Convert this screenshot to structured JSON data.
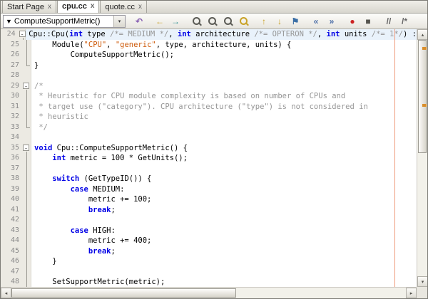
{
  "colors": {
    "keyword": "#0000E6",
    "string": "#CE5B0B",
    "comment": "#969696",
    "plain": "#000000",
    "line-number": "#8A8A8A",
    "gutter-bg": "#ECEAE3",
    "current-line-bg": "#E9F2FB",
    "margin-line": "#EE9B7D",
    "error-mark": "#D98E2B"
  },
  "tabs": {
    "active_index": 1,
    "close_glyph": "x",
    "items": [
      {
        "label": "Start Page"
      },
      {
        "label": "cpu.cc"
      },
      {
        "label": "quote.cc"
      }
    ]
  },
  "toolbar": {
    "selector": {
      "icon": "member-filter-icon",
      "icon_glyph": "▼",
      "icon_color": "#E8A33D",
      "value": "ComputeSupportMetric()",
      "arrow_glyph": "▾"
    },
    "groups": [
      [
        {
          "name": "last-edit-location-icon",
          "glyph": "↶",
          "color": "#8A63B3"
        }
      ],
      [
        {
          "name": "back-icon",
          "glyph": "←",
          "color": "#C9A227"
        },
        {
          "name": "forward-icon",
          "glyph": "→",
          "color": "#2F8F8F"
        }
      ],
      [
        {
          "name": "find-icon",
          "mag": true,
          "color": "#5B5B55"
        },
        {
          "name": "find-next-icon",
          "mag": true,
          "color": "#5B5B55"
        },
        {
          "name": "find-previous-icon",
          "mag": true,
          "color": "#5B5B55"
        },
        {
          "name": "toggle-highlight-icon",
          "mag": true,
          "color": "#C9A227"
        }
      ],
      [
        {
          "name": "previous-bookmark-icon",
          "glyph": "↑",
          "color": "#C9A227"
        },
        {
          "name": "next-bookmark-icon",
          "glyph": "↓",
          "color": "#C9A227"
        },
        {
          "name": "toggle-bookmark-icon",
          "glyph": "⚑",
          "color": "#3A6EA5"
        }
      ],
      [
        {
          "name": "shift-left-icon",
          "glyph": "«",
          "color": "#4A6DA7"
        },
        {
          "name": "shift-right-icon",
          "glyph": "»",
          "color": "#4A6DA7"
        }
      ],
      [
        {
          "name": "start-macro-recording-icon",
          "glyph": "●",
          "color": "#CC2222"
        },
        {
          "name": "stop-macro-recording-icon",
          "glyph": "■",
          "color": "#55544E"
        }
      ],
      [
        {
          "name": "comment-icon",
          "glyph": "//",
          "color": "#666666"
        },
        {
          "name": "uncomment-icon",
          "glyph": "/*",
          "color": "#666666"
        }
      ]
    ]
  },
  "editor": {
    "current_line": 24,
    "fold_glyph": "-",
    "lines": [
      {
        "n": 24,
        "fold": "start",
        "segs": [
          [
            "p",
            "Cpu::Cpu("
          ],
          [
            "k",
            "int"
          ],
          [
            "p",
            " type "
          ],
          [
            "c",
            "/*= MEDIUM */"
          ],
          [
            "p",
            ", "
          ],
          [
            "k",
            "int"
          ],
          [
            "p",
            " architecture "
          ],
          [
            "c",
            "/*= OPTERON */"
          ],
          [
            "p",
            ", "
          ],
          [
            "k",
            "int"
          ],
          [
            "p",
            " units "
          ],
          [
            "c",
            "/*= 1*/"
          ],
          [
            "p",
            ") :"
          ]
        ]
      },
      {
        "n": 25,
        "fold": "mid",
        "segs": [
          [
            "p",
            "    Module("
          ],
          [
            "s",
            "\"CPU\""
          ],
          [
            "p",
            ", "
          ],
          [
            "s",
            "\"generic\""
          ],
          [
            "p",
            ", type, architecture, units) {"
          ]
        ]
      },
      {
        "n": 26,
        "fold": "mid",
        "segs": [
          [
            "p",
            "        ComputeSupportMetric();"
          ]
        ]
      },
      {
        "n": 27,
        "fold": "end",
        "segs": [
          [
            "p",
            "}"
          ]
        ]
      },
      {
        "n": 28,
        "fold": "none",
        "segs": []
      },
      {
        "n": 29,
        "fold": "start",
        "segs": [
          [
            "c",
            "/*"
          ]
        ]
      },
      {
        "n": 30,
        "fold": "mid",
        "segs": [
          [
            "c",
            " * Heuristic for CPU module complexity is based on number of CPUs and"
          ]
        ]
      },
      {
        "n": 31,
        "fold": "mid",
        "segs": [
          [
            "c",
            " * target use (\"category\"). CPU architecture (\"type\") is not considered in"
          ]
        ]
      },
      {
        "n": 32,
        "fold": "mid",
        "segs": [
          [
            "c",
            " * heuristic"
          ]
        ]
      },
      {
        "n": 33,
        "fold": "end",
        "segs": [
          [
            "c",
            " */"
          ]
        ]
      },
      {
        "n": 34,
        "fold": "none",
        "segs": []
      },
      {
        "n": 35,
        "fold": "start",
        "segs": [
          [
            "k",
            "void"
          ],
          [
            "p",
            " Cpu::ComputeSupportMetric() {"
          ]
        ]
      },
      {
        "n": 36,
        "fold": "mid",
        "segs": [
          [
            "p",
            "    "
          ],
          [
            "k",
            "int"
          ],
          [
            "p",
            " metric = 100 * GetUnits();"
          ]
        ]
      },
      {
        "n": 37,
        "fold": "mid",
        "segs": []
      },
      {
        "n": 38,
        "fold": "mid",
        "segs": [
          [
            "p",
            "    "
          ],
          [
            "k",
            "switch"
          ],
          [
            "p",
            " (GetTypeID()) {"
          ]
        ]
      },
      {
        "n": 39,
        "fold": "mid",
        "segs": [
          [
            "p",
            "        "
          ],
          [
            "k",
            "case"
          ],
          [
            "p",
            " MEDIUM:"
          ]
        ]
      },
      {
        "n": 40,
        "fold": "mid",
        "segs": [
          [
            "p",
            "            metric += 100;"
          ]
        ]
      },
      {
        "n": 41,
        "fold": "mid",
        "segs": [
          [
            "p",
            "            "
          ],
          [
            "k",
            "break"
          ],
          [
            "p",
            ";"
          ]
        ]
      },
      {
        "n": 42,
        "fold": "mid",
        "segs": []
      },
      {
        "n": 43,
        "fold": "mid",
        "segs": [
          [
            "p",
            "        "
          ],
          [
            "k",
            "case"
          ],
          [
            "p",
            " HIGH:"
          ]
        ]
      },
      {
        "n": 44,
        "fold": "mid",
        "segs": [
          [
            "p",
            "            metric += 400;"
          ]
        ]
      },
      {
        "n": 45,
        "fold": "mid",
        "segs": [
          [
            "p",
            "            "
          ],
          [
            "k",
            "break"
          ],
          [
            "p",
            ";"
          ]
        ]
      },
      {
        "n": 46,
        "fold": "mid",
        "segs": [
          [
            "p",
            "    }"
          ]
        ]
      },
      {
        "n": 47,
        "fold": "mid",
        "segs": []
      },
      {
        "n": 48,
        "fold": "mid",
        "segs": [
          [
            "p",
            "    SetSupportMetric(metric);"
          ]
        ]
      }
    ]
  },
  "scrollbars": {
    "up_glyph": "▴",
    "down_glyph": "▾",
    "left_glyph": "◂",
    "right_glyph": "▸",
    "vertical": {
      "thumb_top_pct": 0,
      "thumb_height_pct": 48,
      "marks_pct": [
        7,
        29
      ]
    },
    "horizontal": {
      "thumb_left_pct": 0,
      "thumb_width_pct": 57
    }
  }
}
